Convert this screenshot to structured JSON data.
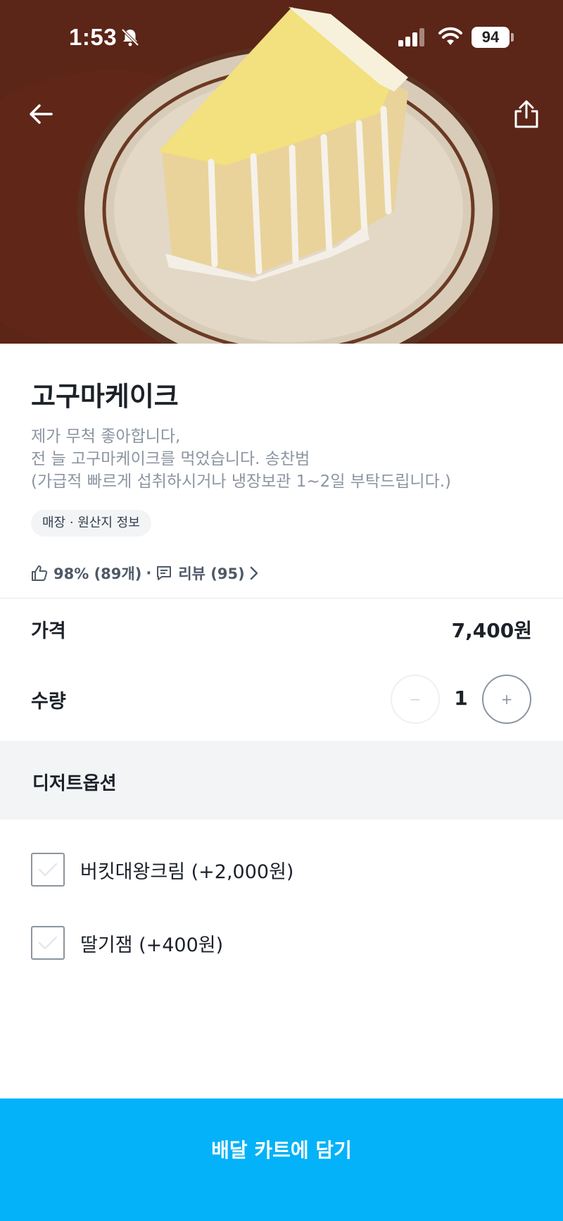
{
  "status_bar": {
    "time": "1:53",
    "battery": "94",
    "icons": [
      "bell-slash-icon",
      "signal-icon",
      "wifi-icon",
      "battery-icon"
    ]
  },
  "header": {
    "back_icon": "arrow-left-icon",
    "share_icon": "share-icon"
  },
  "product": {
    "title": "고구마케이크",
    "description": [
      "제가 무척 좋아합니다,",
      "전 늘 고구마케이크를 먹었습니다. 송찬범",
      "(가급적 빠르게 섭취하시거나 냉장보관 1~2일 부탁드립니다.)"
    ],
    "origin_chip": "매장 · 원산지 정보",
    "rating": {
      "like_text": "98% (89개)",
      "separator": "·",
      "review_text": "리뷰 (95)"
    }
  },
  "price": {
    "label": "가격",
    "value": "7,400원"
  },
  "quantity": {
    "label": "수량",
    "value": "1",
    "minus": "−",
    "plus": "+"
  },
  "options": {
    "title": "디저트옵션",
    "items": [
      {
        "label": "버킷대왕크림 (+2,000원)",
        "checked": false
      },
      {
        "label": "딸기잼 (+400원)",
        "checked": false
      }
    ]
  },
  "cart_button": {
    "label": "배달 카트에 담기"
  },
  "colors": {
    "accent": "#03b2f8",
    "text_primary": "#1c2129",
    "text_secondary": "#8b95a1",
    "band": "#f2f4f6"
  }
}
